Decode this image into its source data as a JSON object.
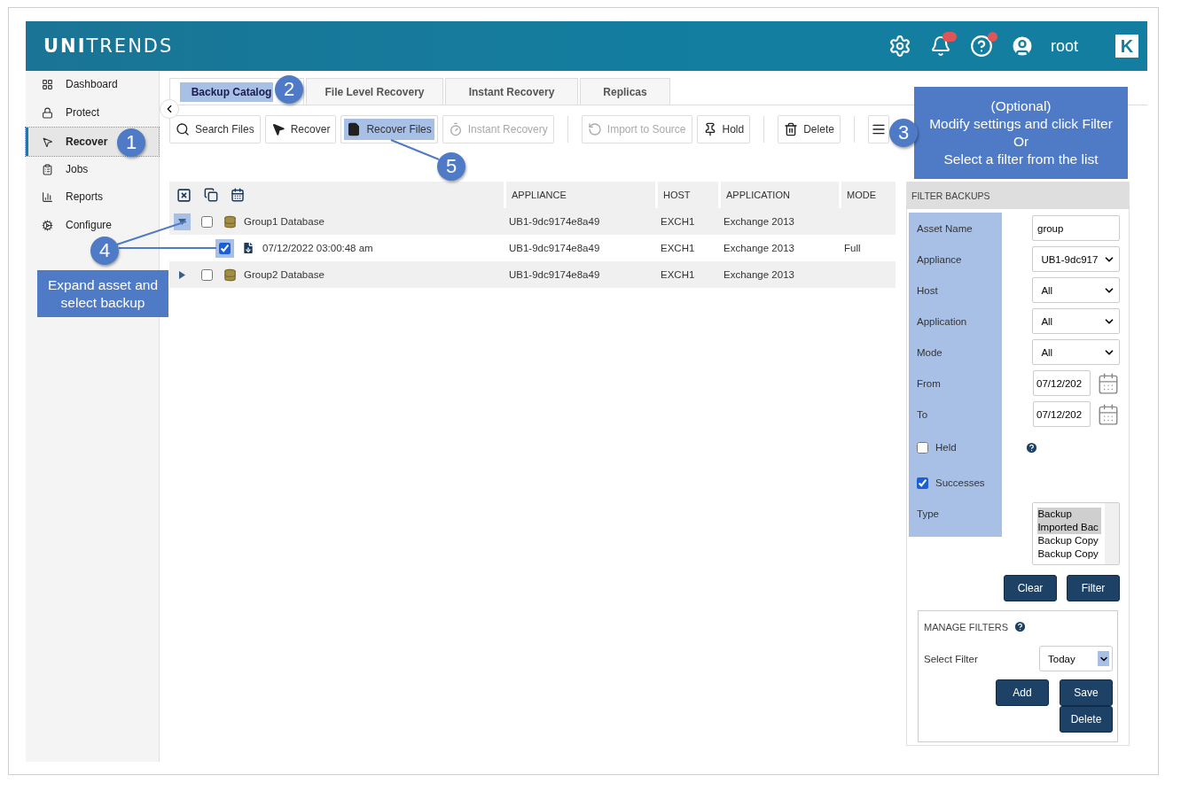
{
  "header": {
    "logo_bold": "UNI",
    "logo_light": "TRENDS",
    "user": "root",
    "partner_logo": "K"
  },
  "sidebar": {
    "items": [
      {
        "label": "Dashboard",
        "selected": false
      },
      {
        "label": "Protect",
        "selected": false
      },
      {
        "label": "Recover",
        "selected": true
      },
      {
        "label": "Jobs",
        "selected": false
      },
      {
        "label": "Reports",
        "selected": false
      },
      {
        "label": "Configure",
        "selected": false
      }
    ]
  },
  "tabs": [
    {
      "label": "Backup Catalog",
      "selected": true
    },
    {
      "label": "File Level Recovery",
      "selected": false
    },
    {
      "label": "Instant Recovery",
      "selected": false
    },
    {
      "label": "Replicas",
      "selected": false
    }
  ],
  "toolbar": [
    {
      "kind": "search",
      "label": "Search Files",
      "disabled": false
    },
    {
      "kind": "recover",
      "label": "Recover",
      "disabled": false
    },
    {
      "kind": "files",
      "label": "Recover Files",
      "disabled": false
    },
    {
      "kind": "instant",
      "label": "Instant Recovery",
      "disabled": true
    },
    {
      "kind": "separator"
    },
    {
      "kind": "import",
      "label": "Import to Source",
      "disabled": true
    },
    {
      "kind": "hold",
      "label": "Hold",
      "disabled": false
    },
    {
      "kind": "separator"
    },
    {
      "kind": "delete",
      "label": "Delete",
      "disabled": false
    },
    {
      "kind": "separator"
    },
    {
      "kind": "view"
    }
  ],
  "table": {
    "columns": [
      "APPLIANCE",
      "HOST",
      "APPLICATION",
      "MODE"
    ],
    "rows": [
      {
        "name": "Group1 Database",
        "expanded": true,
        "checked": false,
        "appliance": "UB1-9dc9174e8a49",
        "host": "EXCH1",
        "application": "Exchange 2013",
        "children": [
          {
            "name": "07/12/2022 03:00:48 am",
            "checked": true,
            "appliance": "UB1-9dc9174e8a49",
            "host": "EXCH1",
            "application": "Exchange 2013",
            "mode": "Full"
          }
        ]
      },
      {
        "name": "Group2 Database",
        "expanded": false,
        "checked": false,
        "appliance": "UB1-9dc9174e8a49",
        "host": "EXCH1",
        "application": "Exchange 2013"
      }
    ]
  },
  "filter_panel": {
    "title": "FILTER BACKUPS",
    "fields": [
      {
        "kind": "text",
        "label": "Asset Name",
        "value": "group"
      },
      {
        "kind": "select",
        "label": "Appliance",
        "value": "UB1-9dc917"
      },
      {
        "kind": "select",
        "label": "Host",
        "value": "All"
      },
      {
        "kind": "select",
        "label": "Application",
        "value": "All"
      },
      {
        "kind": "select",
        "label": "Mode",
        "value": "All"
      },
      {
        "kind": "date",
        "label": "From",
        "value": "07/12/202"
      },
      {
        "kind": "date",
        "label": "To",
        "value": "07/12/202"
      },
      {
        "kind": "checkbox",
        "label": "Held",
        "checked": false,
        "help": true
      },
      {
        "kind": "checkbox",
        "label": "Successes",
        "checked": true,
        "help": false
      },
      {
        "kind": "list",
        "label": "Type",
        "options": [
          {
            "label": "Backup",
            "selected": true
          },
          {
            "label": "Imported Bac",
            "selected": true
          },
          {
            "label": "Backup Copy",
            "selected": false
          },
          {
            "label": "Backup Copy",
            "selected": false
          }
        ]
      }
    ],
    "buttons": [
      "Clear",
      "Filter"
    ],
    "manage": {
      "title": "MANAGE FILTERS",
      "select_label": "Select Filter",
      "select_value": "Today",
      "buttons": [
        "Add",
        "Save",
        "Delete"
      ]
    }
  },
  "annotations": {
    "callouts": [
      "1",
      "2",
      "3",
      "4",
      "5"
    ],
    "notes": [
      "(Optional)\nModify settings and click Filter\nOr\nSelect a filter from the list",
      "Expand asset and\nselect backup"
    ]
  }
}
